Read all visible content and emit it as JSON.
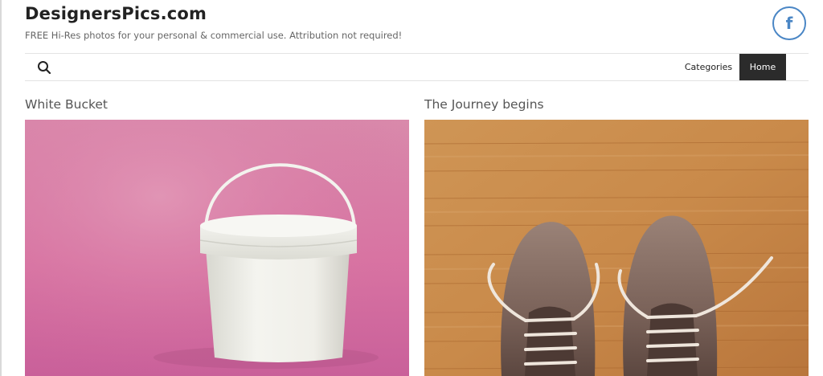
{
  "site": {
    "title": "DesignersPics.com",
    "tagline": "FREE Hi-Res photos for your personal & commercial use. Attribution not required!"
  },
  "social": {
    "facebook_icon": "f"
  },
  "nav": {
    "search_icon": "search-icon",
    "items": [
      {
        "label": "Categories"
      },
      {
        "label": "Home",
        "active": true
      }
    ]
  },
  "posts": [
    {
      "title": "White Bucket"
    },
    {
      "title": "The Journey begins"
    }
  ],
  "colors": {
    "accent_blue": "#4a86c5",
    "nav_active_bg": "#2b2b2b",
    "pink_backdrop": "#d46e9e",
    "wood_floor": "#c98a4a"
  }
}
